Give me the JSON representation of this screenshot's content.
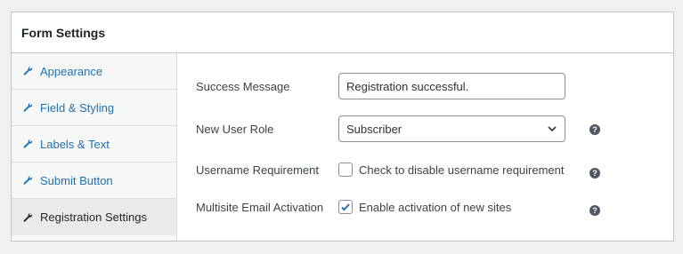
{
  "panel": {
    "title": "Form Settings"
  },
  "sidebar": {
    "items": [
      {
        "label": "Appearance",
        "icon": "wrench-icon"
      },
      {
        "label": "Field & Styling",
        "icon": "wrench-icon"
      },
      {
        "label": "Labels & Text",
        "icon": "wrench-icon"
      },
      {
        "label": "Submit Button",
        "icon": "wrench-icon"
      },
      {
        "label": "Registration Settings",
        "icon": "wrench-icon",
        "active": true
      }
    ]
  },
  "settings": {
    "success_message": {
      "label": "Success Message",
      "value": "Registration successful."
    },
    "new_user_role": {
      "label": "New User Role",
      "value": "Subscriber"
    },
    "username_requirement": {
      "label": "Username Requirement",
      "checkbox_label": "Check to disable username requirement",
      "checked": false
    },
    "multisite_activation": {
      "label": "Multisite Email Activation",
      "checkbox_label": "Enable activation of new sites",
      "checked": true
    },
    "help_icon": "?"
  },
  "colors": {
    "link": "#2271b1",
    "border": "#c3c4c7",
    "help_icon_bg": "#50575e"
  }
}
